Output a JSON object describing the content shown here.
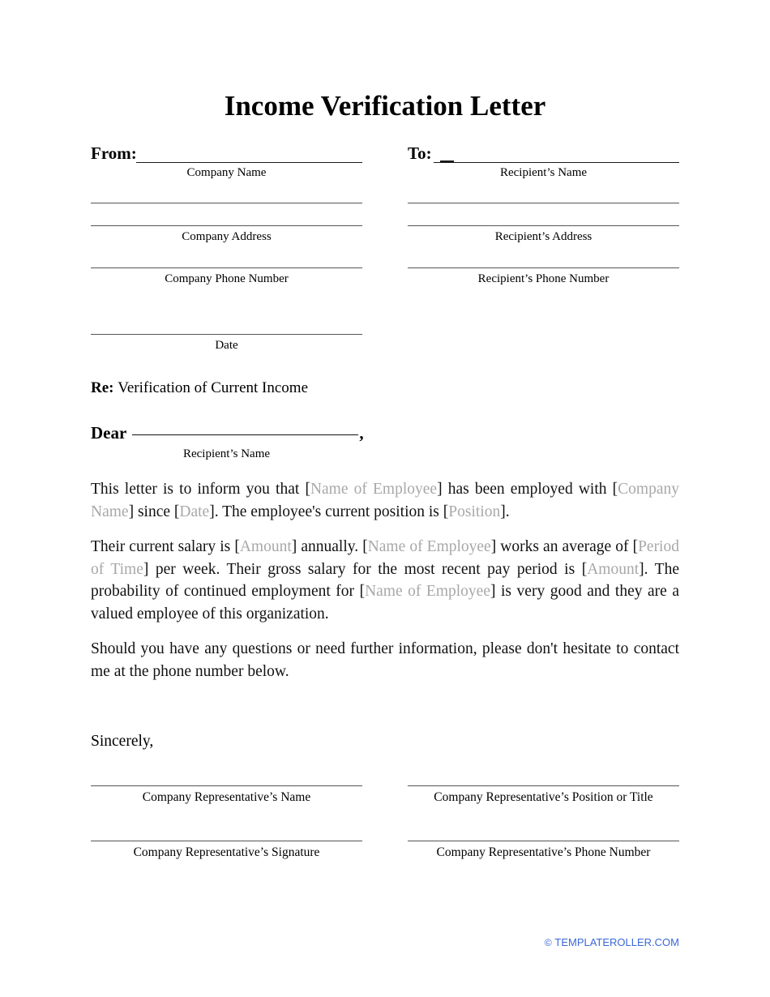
{
  "document": {
    "title": "Income Verification Letter"
  },
  "sender": {
    "label": "From:",
    "captions": {
      "name": "Company Name",
      "address": "Company Address",
      "phone": "Company Phone Number",
      "date": "Date"
    }
  },
  "recipient": {
    "label": "To:",
    "captions": {
      "name": "Recipient’s Name",
      "address": "Recipient’s Address",
      "phone": "Recipient’s Phone Number"
    }
  },
  "subject": {
    "label": "Re:",
    "text": "Verification of Current Income"
  },
  "salutation": {
    "label": "Dear",
    "comma": ",",
    "caption": "Recipient’s Name"
  },
  "body": {
    "paragraph1": {
      "t1": "This letter is to inform you that ",
      "b1o": "[",
      "p1": "Name of Employee",
      "b1c": "]",
      "t2": " has been employed with ",
      "b2o": "[",
      "p2": "Company Name",
      "b2c": "]",
      "t3": " since ",
      "b3o": "[",
      "p3": "Date",
      "b3c": "]",
      "t4": ". The employee's current position is ",
      "b4o": "[",
      "p4": "Position",
      "b4c": "]",
      "t5": "."
    },
    "paragraph2": {
      "t1": "Their current salary is ",
      "b1o": "[",
      "p1": "Amount",
      "b1c": "]",
      "t2": " annually. ",
      "b2o": "[",
      "p2": "Name of Employee",
      "b2c": "]",
      "t3": " works an average of ",
      "b3o": "[",
      "p3": "Period of Time",
      "b3c": "]",
      "t4": " per week. Their gross salary for the most recent pay period is ",
      "b4o": "[",
      "p4": "Amount",
      "b4c": "]",
      "t5": ". The probability of continued employment for ",
      "b5o": "[",
      "p5": "Name of Employee",
      "b5c": "]",
      "t6": " is very good and they are a valued employee of this organization."
    },
    "paragraph3": {
      "t1": "Should you have any questions or need further information, please don't hesitate to contact me at the phone number below."
    }
  },
  "closing": {
    "sincerely": "Sincerely,"
  },
  "signature": {
    "rep_name": "Company Representative’s Name",
    "rep_position": "Company Representative’s Position or Title",
    "rep_signature": "Company Representative’s Signature",
    "rep_phone": "Company Representative’s Phone Number"
  },
  "footer": {
    "copyright_mark": "©",
    "text": "TEMPLATEROLLER.COM",
    "color": "#3b68d8"
  }
}
